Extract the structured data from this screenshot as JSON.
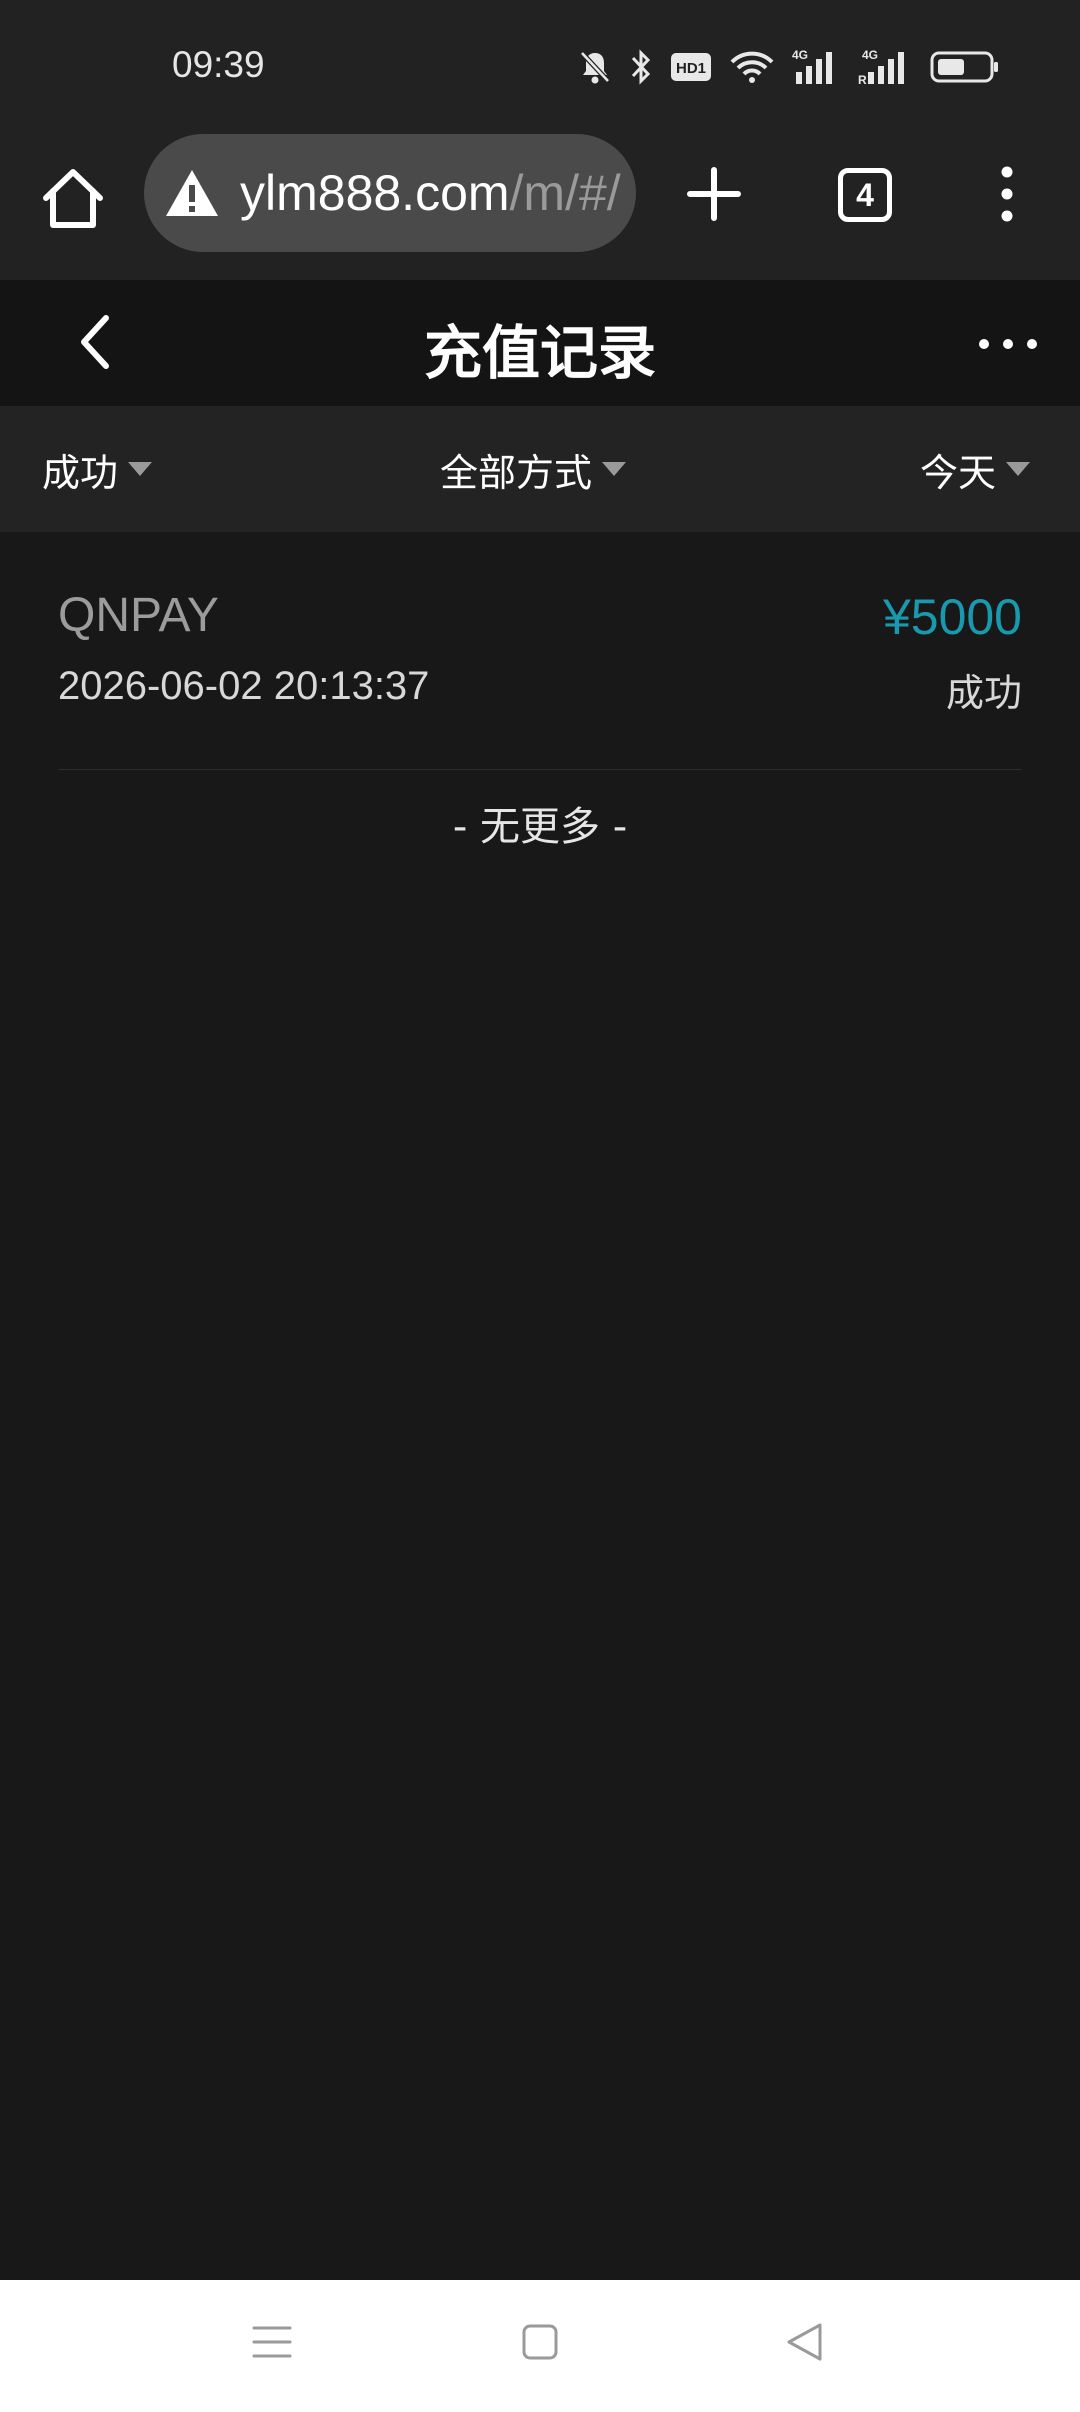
{
  "status_bar": {
    "time": "09:39",
    "icons": [
      "mute-bell-icon",
      "bluetooth-icon",
      "hd-icon",
      "wifi-icon",
      "signal-4g-icon",
      "signal-4g-roaming-icon",
      "battery-icon"
    ],
    "hd_label": "HD1",
    "net_label": "4G",
    "roaming_label": "R"
  },
  "browser": {
    "url_host": "ylm888.com",
    "url_path": "/m/#/",
    "tab_count": "4"
  },
  "header": {
    "title": "充值记录"
  },
  "filters": {
    "status": "成功",
    "method": "全部方式",
    "date": "今天"
  },
  "records": [
    {
      "method": "QNPAY",
      "amount": "¥5000",
      "time": "2026-06-02 20:13:37",
      "status": "成功"
    }
  ],
  "list_end_text": "- 无更多 -",
  "colors": {
    "amount": "#1a98ae",
    "background": "#181818",
    "header": "#141414",
    "filter_bar": "#232323"
  }
}
